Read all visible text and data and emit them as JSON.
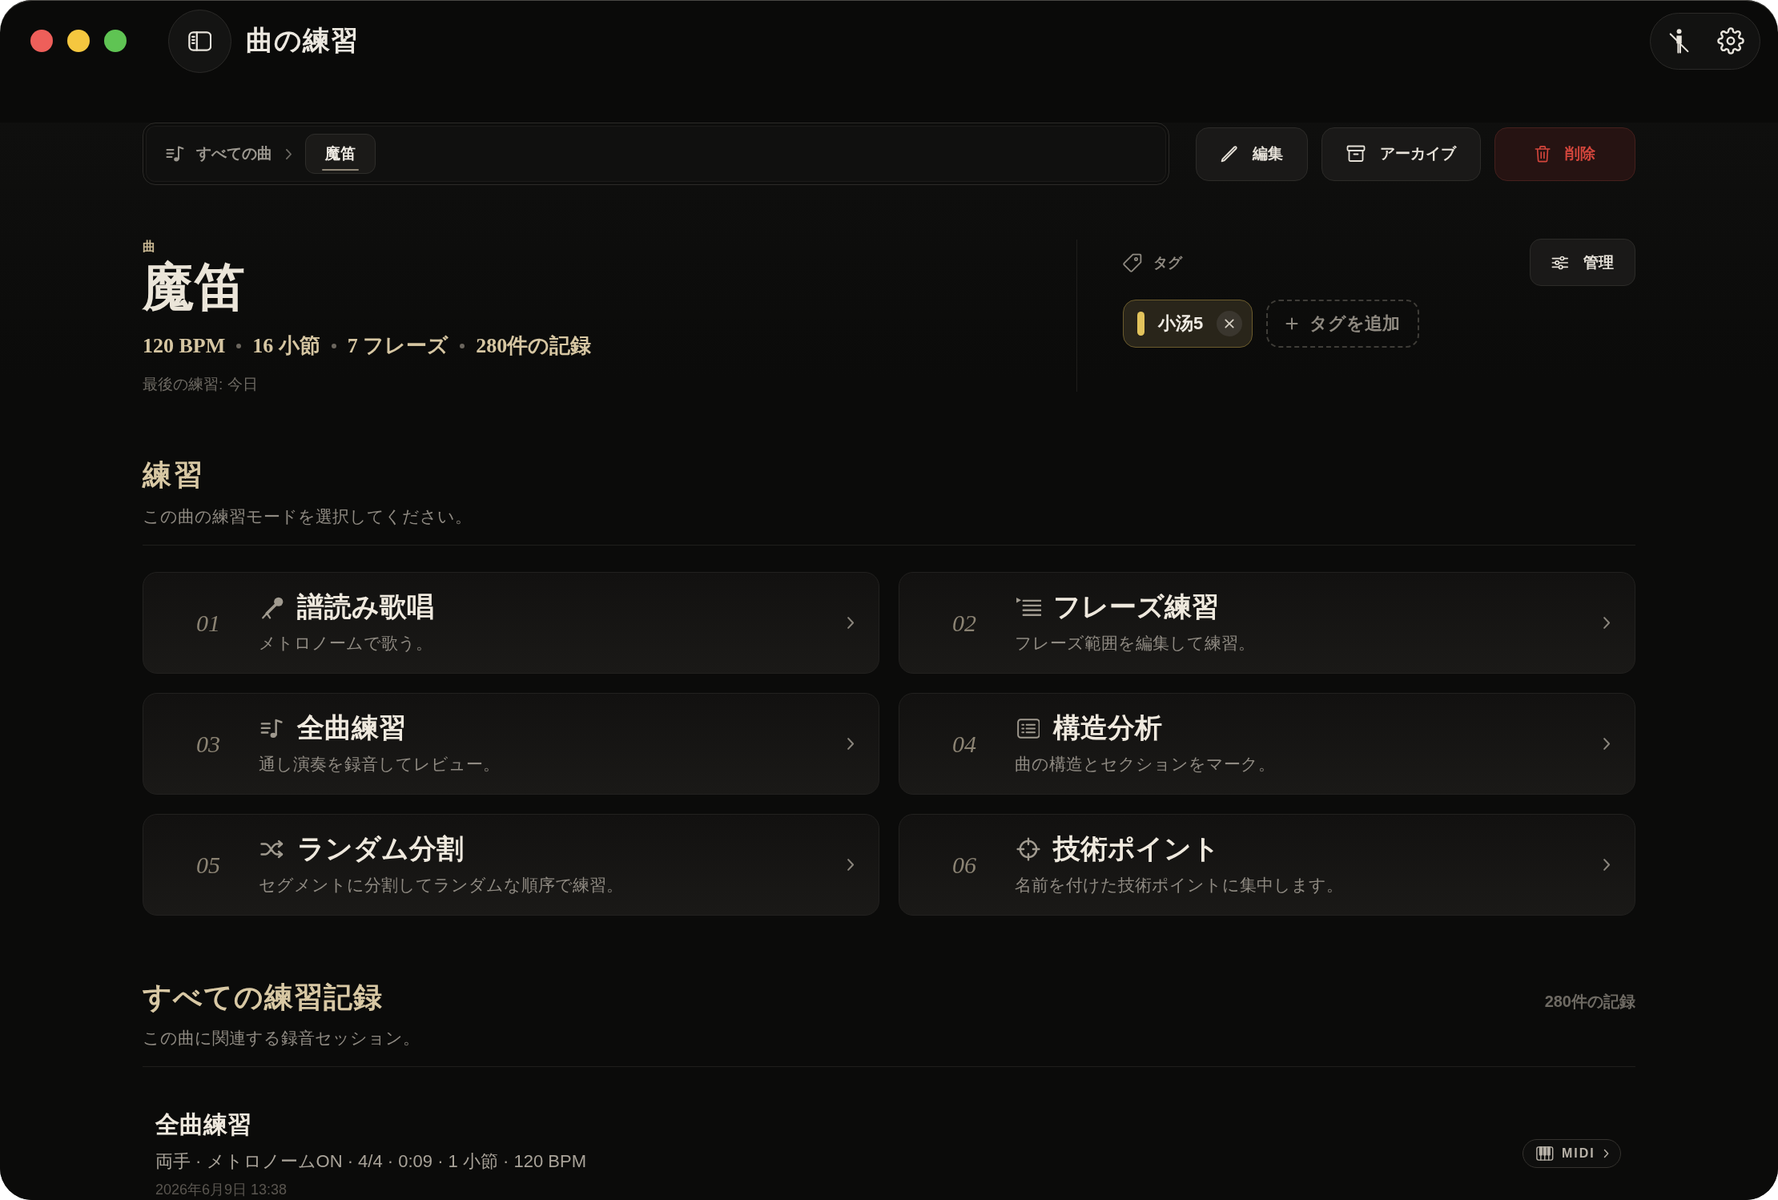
{
  "window": {
    "title": "曲の練習"
  },
  "breadcrumb": [
    {
      "label": "すべての曲",
      "selected": false
    },
    {
      "label": "魔笛",
      "selected": true
    }
  ],
  "actions": [
    {
      "label": "編集",
      "kind": "edit"
    },
    {
      "label": "アーカイブ",
      "kind": "archive"
    },
    {
      "label": "削除",
      "kind": "delete"
    }
  ],
  "song": {
    "label": "曲",
    "title": "魔笛",
    "stats": [
      "120 BPM",
      "16 小節",
      "7 フレーズ",
      "280件の記録"
    ],
    "last_practice": "最後の練習: 今日"
  },
  "tags": {
    "label": "タグ",
    "manage_button": "管理",
    "items": [
      {
        "label": "小汤5",
        "color": "#e2c35c"
      }
    ],
    "add_button": "タグを追加"
  },
  "practice": {
    "title": "練習",
    "subtitle": "この曲の練習モードを選択してください。",
    "modes": [
      {
        "number": "01",
        "kind": "sing",
        "title": "譜読み歌唱",
        "description": "メトロノームで歌う。"
      },
      {
        "number": "02",
        "kind": "phrase",
        "title": "フレーズ練習",
        "description": "フレーズ範囲を編集して練習。"
      },
      {
        "number": "03",
        "kind": "full",
        "title": "全曲練習",
        "description": "通し演奏を録音してレビュー。"
      },
      {
        "number": "04",
        "kind": "structure",
        "title": "構造分析",
        "description": "曲の構造とセクションをマーク。"
      },
      {
        "number": "05",
        "kind": "random",
        "title": "ランダム分割",
        "description": "セグメントに分割してランダムな順序で練習。"
      },
      {
        "number": "06",
        "kind": "technique",
        "title": "技術ポイント",
        "description": "名前を付けた技術ポイントに集中します。"
      }
    ]
  },
  "records": {
    "title": "すべての練習記録",
    "count": "280件の記録",
    "subtitle": "この曲に関連する録音セッション。",
    "sessions": [
      {
        "title": "全曲練習",
        "details": "両手 · メトロノームON · 4/4 · 0:09 · 1 小節 · 120 BPM",
        "date": "2026年6月9日 13:38",
        "midi_button": "MIDI"
      }
    ]
  }
}
